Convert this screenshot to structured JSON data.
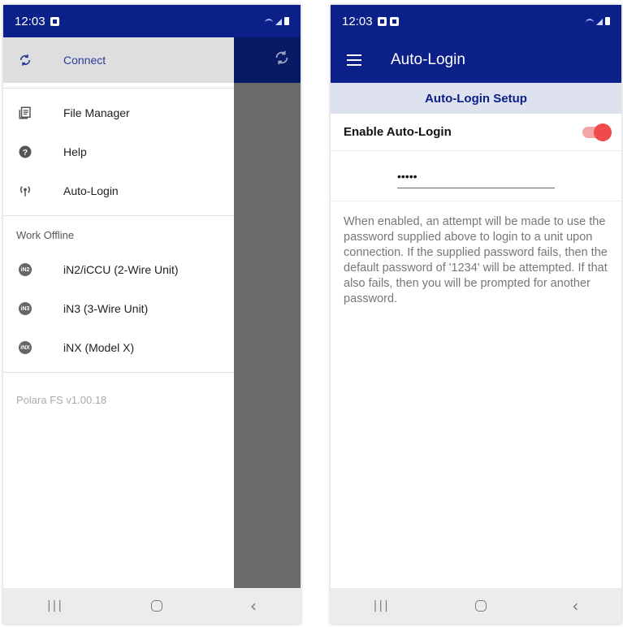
{
  "colors": {
    "primary": "#0b2088",
    "toggle_on": "#ef4b4b",
    "section_bg": "#dde2ee"
  },
  "left": {
    "status": {
      "time": "12:03"
    },
    "drawer": {
      "connect": {
        "label": "Connect",
        "icon": "sync-icon"
      },
      "items": [
        {
          "label": "File Manager",
          "icon": "file-manager-icon"
        },
        {
          "label": "Help",
          "icon": "help-icon"
        },
        {
          "label": "Auto-Login",
          "icon": "broadcast-icon"
        }
      ],
      "section_title": "Work Offline",
      "units": [
        {
          "badge": "iN2",
          "label": "iN2/iCCU (2-Wire Unit)"
        },
        {
          "badge": "iN3",
          "label": "iN3 (3-Wire Unit)"
        },
        {
          "badge": "iNX",
          "label": "iNX (Model X)"
        }
      ],
      "version": "Polara FS v1.00.18"
    }
  },
  "right": {
    "status": {
      "time": "12:03"
    },
    "app_title": "Auto-Login",
    "section_header": "Auto-Login Setup",
    "enable_label": "Enable Auto-Login",
    "enable_on": true,
    "password_value": "•••••",
    "description": "When enabled, an attempt will be made to use the password supplied above to login to a unit upon connection. If the supplied password fails, then the default password of '1234' will be attempted. If that also fails, then you will be prompted for another password."
  }
}
